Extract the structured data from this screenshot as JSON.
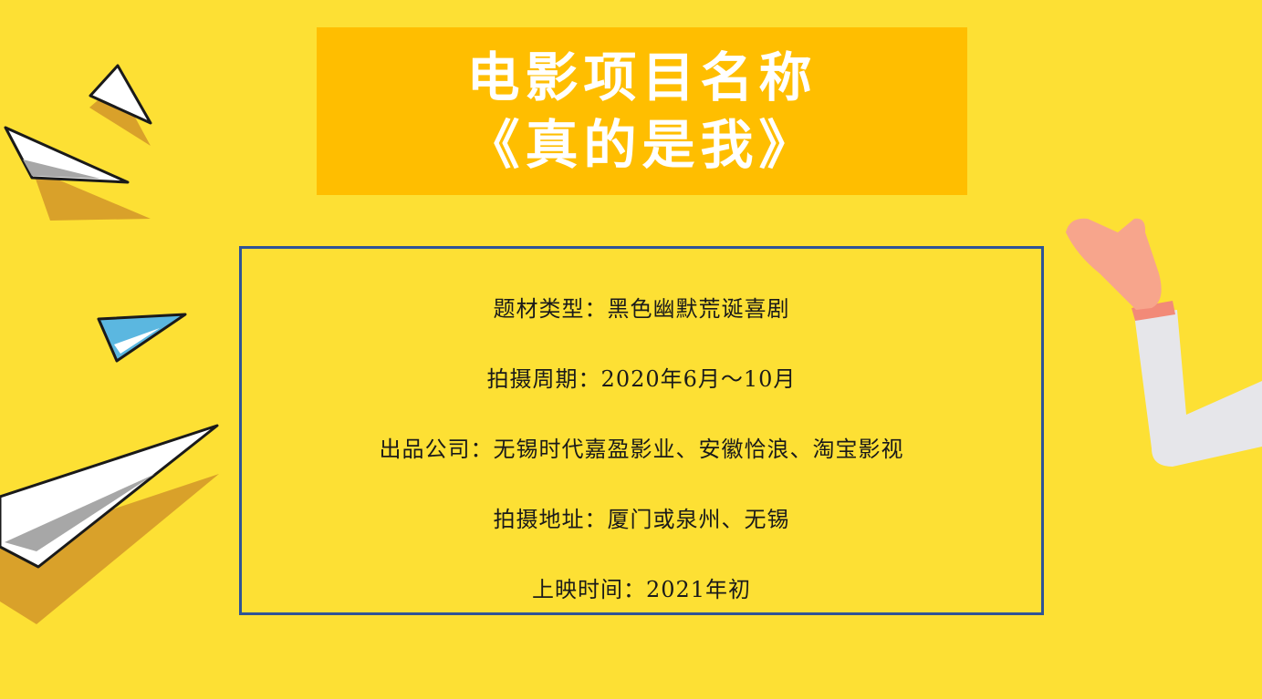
{
  "title": {
    "line1": "电影项目名称",
    "line2": "《真的是我》"
  },
  "info": {
    "genre": "题材类型：黑色幽默荒诞喜剧",
    "shooting_period": "拍摄周期：2020年6月～10月",
    "producers": "出品公司：无锡时代嘉盈影业、安徽恰浪、淘宝影视",
    "locations": "拍摄地址：厦门或泉州、无锡",
    "release": "上映时间：2021年初"
  },
  "colors": {
    "background": "#FDE034",
    "title_box": "#FFBE00",
    "info_border": "#2F5496",
    "accent_blue": "#5BB7E0",
    "sleeve": "#E6E6EA",
    "hand": "#F7A58C"
  },
  "icons": [
    "paper-plane-icon",
    "waving-hand-icon"
  ]
}
